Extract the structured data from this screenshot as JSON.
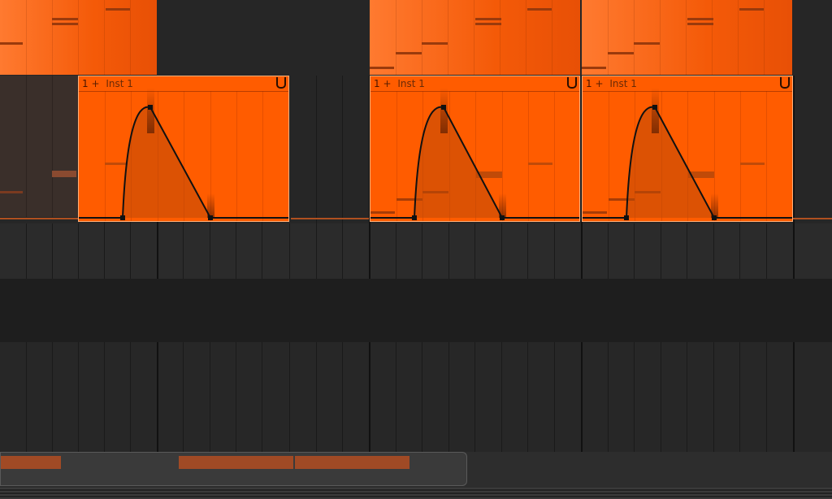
{
  "arrangement": {
    "automation_clips": [
      {
        "number": "1",
        "separator": "+",
        "name": "Inst 1"
      },
      {
        "number": "1",
        "separator": "+",
        "name": "Inst 1"
      },
      {
        "number": "1",
        "separator": "+",
        "name": "Inst 1"
      }
    ]
  },
  "colors": {
    "clip_orange": "#ff5c00",
    "clip_border": "#ffb07a",
    "background": "#2a2a2a",
    "note": "#9a3a0c"
  }
}
